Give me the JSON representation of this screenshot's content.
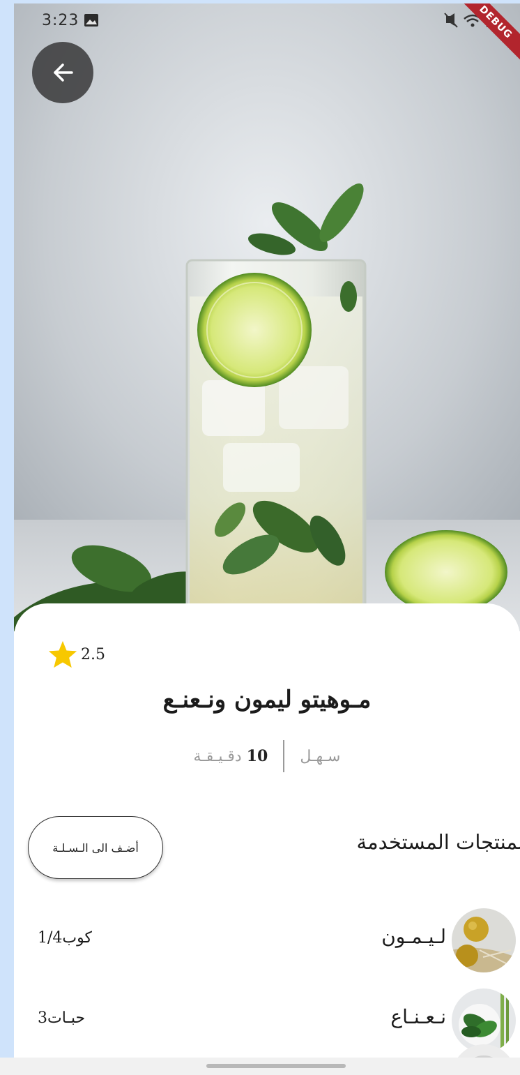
{
  "status_bar": {
    "time": "3:23",
    "debug_label": "DEBUG"
  },
  "hero": {
    "image_icon": "mojito-glass-photo"
  },
  "recipe": {
    "rating": "2.5",
    "title": "مـوهيتو ليمون ونـعنـع",
    "difficulty": "سـهـل",
    "time_value": "10",
    "time_unit": "دقـيـقـة"
  },
  "ingredients_section": {
    "title": "لمنتجات المستخدمة",
    "add_to_cart_label": "أضـف الى الـسـلـة",
    "items": [
      {
        "name": "لـيـمـون",
        "quantity": "كوب1/4",
        "image_icon": "lemons-photo"
      },
      {
        "name": "نـعـنـاع",
        "quantity": "حبـات3",
        "image_icon": "mint-photo"
      }
    ]
  },
  "colors": {
    "star": "#f7c800",
    "back_button_bg": "#3c3c3e",
    "page_bg": "#cfe3fb",
    "debug_ribbon": "#b2252d"
  }
}
